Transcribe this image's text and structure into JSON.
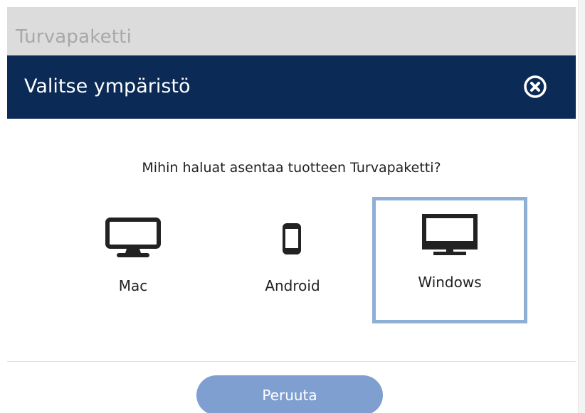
{
  "app": {
    "background_title": "Turvapaketti"
  },
  "dialog": {
    "title": "Valitse ympäristö",
    "close_icon": "close-circle-icon",
    "question": "Mihin haluat asentaa tuotteen Turvapaketti?",
    "options": [
      {
        "label": "Mac",
        "icon": "monitor-icon",
        "selected": false
      },
      {
        "label": "Android",
        "icon": "smartphone-icon",
        "selected": false
      },
      {
        "label": "Windows",
        "icon": "desktop-monitor-icon",
        "selected": true
      }
    ],
    "cancel_label": "Peruuta"
  },
  "colors": {
    "header_bg": "#0b2a55",
    "selected_border": "#8fb0d6",
    "cancel_button": "#7f9fd1",
    "background_titlebar": "#dcdcdc"
  }
}
